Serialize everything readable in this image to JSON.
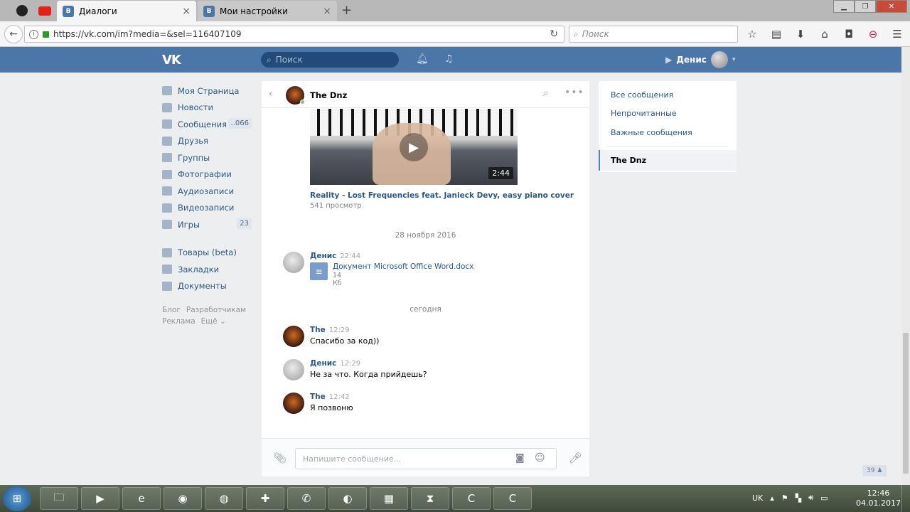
{
  "browser": {
    "tabs": [
      {
        "title": "Диалоги",
        "close": "×"
      },
      {
        "title": "Мои настройки",
        "close": "×"
      }
    ],
    "new_tab": "+",
    "url": "https://vk.com/im?media=&sel=116407109",
    "search_placeholder": "Поиск"
  },
  "vk_header": {
    "logo": "VK",
    "search_placeholder": "Поиск",
    "user_name": "Денис"
  },
  "left_nav": {
    "items": [
      {
        "label": "Моя Страница"
      },
      {
        "label": "Новости"
      },
      {
        "label": "Сообщения",
        "badge": "..066"
      },
      {
        "label": "Друзья"
      },
      {
        "label": "Группы"
      },
      {
        "label": "Фотографии"
      },
      {
        "label": "Аудиозаписи"
      },
      {
        "label": "Видеозаписи"
      },
      {
        "label": "Игры",
        "badge": "23"
      }
    ],
    "items2": [
      {
        "label": "Товары (beta)"
      },
      {
        "label": "Закладки"
      },
      {
        "label": "Документы"
      }
    ],
    "footer": [
      "Блог",
      "Разработчикам",
      "Реклама",
      "Ещё ⌄"
    ]
  },
  "chat": {
    "peer_name": "The Dnz",
    "video": {
      "duration": "2:44",
      "title": "Reality - Lost Frequencies feat. Janieck Devy, easy piano cover",
      "views": "541 просмотр"
    },
    "date1": "28 ноября 2016",
    "doc_msg": {
      "author": "Денис",
      "time": "22:44",
      "doc_name": "Документ Microsoft Office Word.docx",
      "doc_size": "14 Кб"
    },
    "date2": "сегодня",
    "messages": [
      {
        "author": "The",
        "time": "12:29",
        "text": "Спасибо за код))"
      },
      {
        "author": "Денис",
        "time": "12:29",
        "text": "Не за что. Когда прийдешь?"
      },
      {
        "author": "The",
        "time": "12:42",
        "text": "Я позвоню"
      }
    ],
    "input_placeholder": "Напишите сообщение..."
  },
  "right_nav": {
    "items": [
      "Все сообщения",
      "Непрочитанные",
      "Важные сообщения"
    ],
    "selected": "The Dnz"
  },
  "online_counter": "39 ♟",
  "taskbar": {
    "language": "UK",
    "time": "12:46",
    "date": "04.01.2017"
  },
  "colors": {
    "vk_blue": "#4a76a8",
    "link": "#2a5885",
    "background": "#edeef0"
  }
}
